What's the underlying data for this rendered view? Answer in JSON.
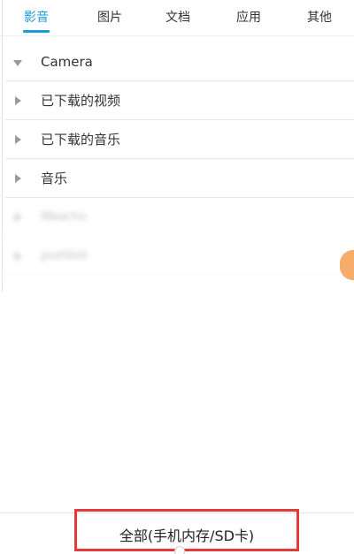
{
  "tabs": [
    {
      "label": "影音",
      "active": true
    },
    {
      "label": "图片",
      "active": false
    },
    {
      "label": "文档",
      "active": false
    },
    {
      "label": "应用",
      "active": false
    },
    {
      "label": "其他",
      "active": false
    }
  ],
  "folders": [
    {
      "label": "Camera",
      "state": "expanded"
    },
    {
      "label": "已下载的视频",
      "state": "collapsed"
    },
    {
      "label": "已下载的音乐",
      "state": "collapsed"
    },
    {
      "label": "音乐",
      "state": "collapsed"
    },
    {
      "label": "Weacho",
      "state": "collapsed",
      "blurred": true
    },
    {
      "label": "pushbot",
      "state": "collapsed",
      "blurred": true
    }
  ],
  "bottom": {
    "storage_selector": "全部(手机内存/SD卡)"
  },
  "colors": {
    "accent": "#1a9be0",
    "highlight": "#e23a36",
    "bubble": "#f7a35a"
  },
  "icons": {
    "expanded": "caret-down-icon",
    "collapsed": "caret-right-icon"
  }
}
